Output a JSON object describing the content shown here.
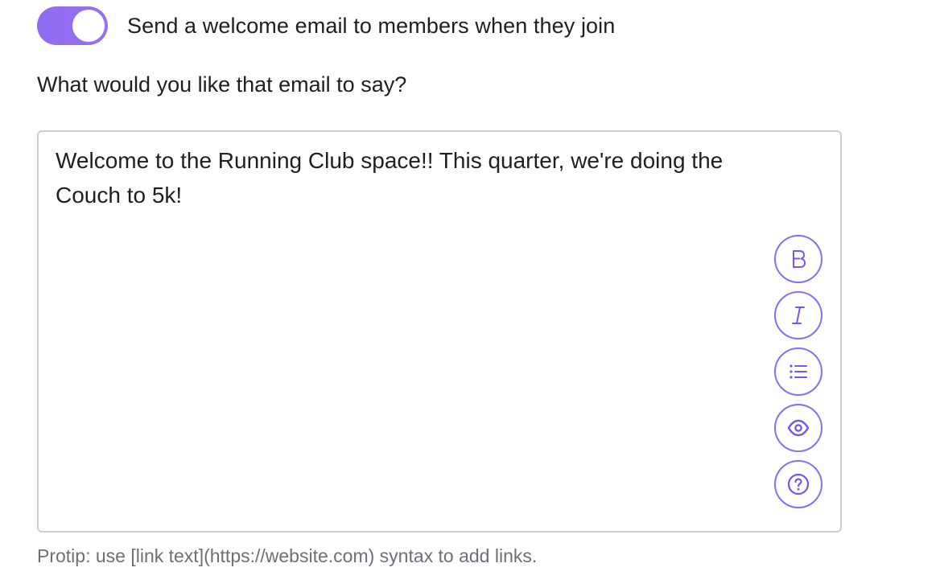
{
  "toggle": {
    "label": "Send a welcome email to members when they join",
    "on": true,
    "accent_color": "#9470f2"
  },
  "question": "What would you like that email to say?",
  "editor": {
    "value": "Welcome to the Running Club space!! This quarter, we're doing the Couch to 5k!",
    "toolbar": [
      {
        "name": "bold-icon",
        "glyph": "B"
      },
      {
        "name": "italic-icon",
        "glyph": "I"
      },
      {
        "name": "list-icon",
        "glyph": "list"
      },
      {
        "name": "preview-eye-icon",
        "glyph": "eye"
      },
      {
        "name": "help-icon",
        "glyph": "?"
      }
    ]
  },
  "protip": "Protip: use [link text](https://website.com) syntax to add links."
}
